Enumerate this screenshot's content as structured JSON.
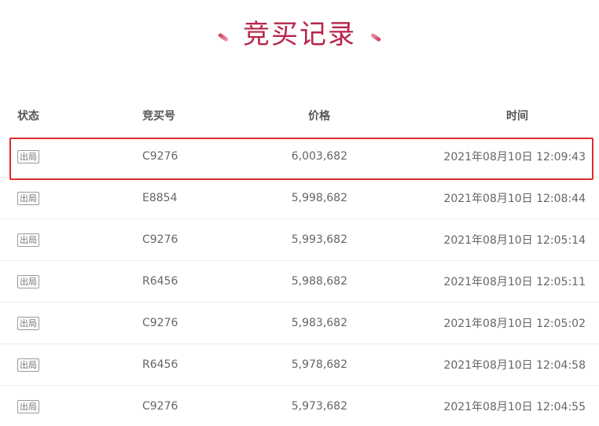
{
  "title": "竞买记录",
  "headers": {
    "status": "状态",
    "code": "竞买号",
    "price": "价格",
    "time": "时间"
  },
  "rows": [
    {
      "status": "出局",
      "code": "C9276",
      "price": "6,003,682",
      "time": "2021年08月10日 12:09:43"
    },
    {
      "status": "出局",
      "code": "E8854",
      "price": "5,998,682",
      "time": "2021年08月10日 12:08:44"
    },
    {
      "status": "出局",
      "code": "C9276",
      "price": "5,993,682",
      "time": "2021年08月10日 12:05:14"
    },
    {
      "status": "出局",
      "code": "R6456",
      "price": "5,988,682",
      "time": "2021年08月10日 12:05:11"
    },
    {
      "status": "出局",
      "code": "C9276",
      "price": "5,983,682",
      "time": "2021年08月10日 12:05:02"
    },
    {
      "status": "出局",
      "code": "R6456",
      "price": "5,978,682",
      "time": "2021年08月10日 12:04:58"
    },
    {
      "status": "出局",
      "code": "C9276",
      "price": "5,973,682",
      "time": "2021年08月10日 12:04:55"
    }
  ],
  "colors": {
    "title": "#b8254a",
    "highlight_border": "#e02a2a"
  }
}
